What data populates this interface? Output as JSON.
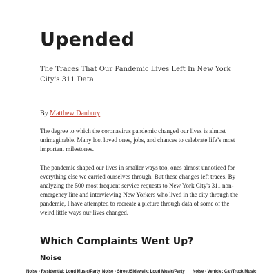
{
  "article": {
    "title": "Upended",
    "subtitle": "The Traces That Our Pandemic Lives Left In New York City's 311 Data",
    "byline_prefix": "By ",
    "author": "Matthew Danbury",
    "paragraphs": [
      "The degree to which the coronavirus pandemic changed our lives is almost unimaginable. Many lost loved ones, jobs, and chances to celebrate life’s most important milestones.",
      "The pandemic shaped our lives in smaller ways too, ones almost unnoticed for everything else we carried ourselves through. But these changes left traces. By analyzing the 500 most frequent service requests to New York City's 311 non-emergency line and interviewing New Yorkers who lived in the city through the pandemic, I have attempted to recreate a picture through data of some of the weird little ways our lives changed."
    ],
    "section_heading": "Which Complaints Went Up?",
    "subsection_heading": "Noise"
  },
  "charts": {
    "labels": [
      "Noise - Residential: Loud Music/Party",
      "Noise - Street/Sidewalk: Loud Music/Party",
      "Noise - Vehicle: Car/Truck Music"
    ]
  },
  "colors": {
    "link": "#c0392b",
    "text": "#222222"
  }
}
